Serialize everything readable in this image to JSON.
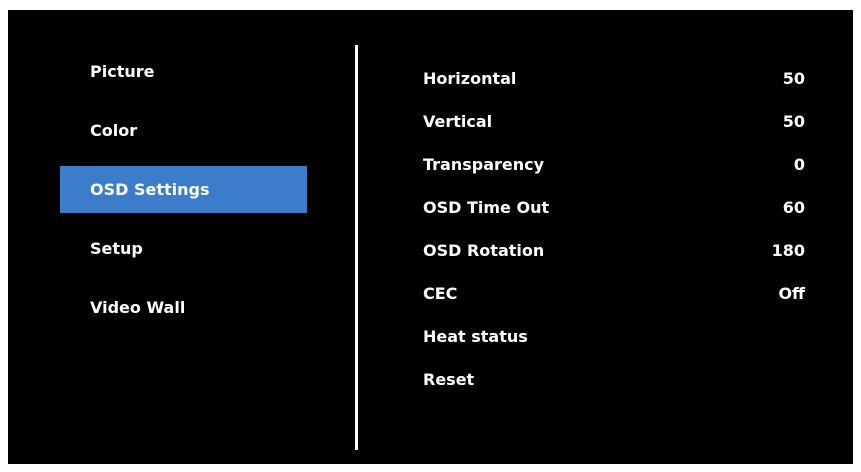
{
  "menu": {
    "items": [
      {
        "label": "Picture",
        "selected": false
      },
      {
        "label": "Color",
        "selected": false
      },
      {
        "label": "OSD Settings",
        "selected": true
      },
      {
        "label": "Setup",
        "selected": false
      },
      {
        "label": "Video Wall",
        "selected": false
      }
    ]
  },
  "settings": {
    "rows": [
      {
        "label": "Horizontal",
        "value": "50"
      },
      {
        "label": "Vertical",
        "value": "50"
      },
      {
        "label": "Transparency",
        "value": "0"
      },
      {
        "label": "OSD Time Out",
        "value": "60"
      },
      {
        "label": "OSD Rotation",
        "value": "180"
      },
      {
        "label": "CEC",
        "value": "Off"
      },
      {
        "label": "Heat status",
        "value": ""
      },
      {
        "label": "Reset",
        "value": ""
      }
    ]
  },
  "colors": {
    "background": "#000000",
    "selected_highlight": "#3b7dca",
    "text": "#ffffff"
  }
}
